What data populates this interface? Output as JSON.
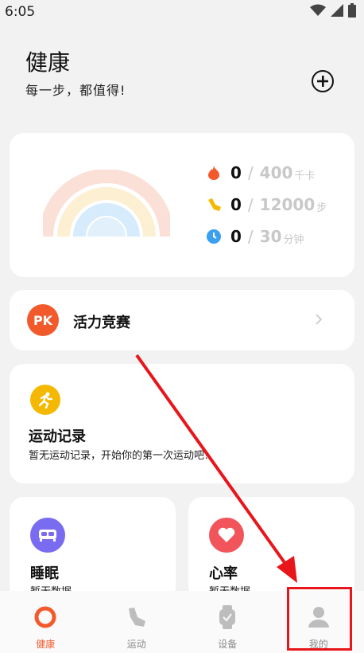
{
  "status_bar": {
    "time": "6:05"
  },
  "header": {
    "title": "健康",
    "subtitle": "每一步，都值得!"
  },
  "summary": {
    "stats": [
      {
        "icon": "flame-icon",
        "value": "0",
        "goal": "400",
        "unit": "千卡",
        "color": "#f25a2c"
      },
      {
        "icon": "shoe-icon",
        "value": "0",
        "goal": "12000",
        "unit": "步",
        "color": "#f5b800"
      },
      {
        "icon": "clock-icon",
        "value": "0",
        "goal": "30",
        "unit": "分钟",
        "color": "#3ba0f0"
      }
    ],
    "separator": "/"
  },
  "pk": {
    "badge": "PK",
    "label": "活力竞赛"
  },
  "workout": {
    "title": "运动记录",
    "description": "暂无运动记录，开始你的第一次运动吧!"
  },
  "tiles": {
    "sleep": {
      "title": "睡眠",
      "subtitle": "暂无数据",
      "color": "#7a6cf0"
    },
    "heart": {
      "title": "心率",
      "subtitle": "暂无数据",
      "color": "#f2545b"
    }
  },
  "nav": {
    "items": [
      {
        "label": "健康",
        "active": true
      },
      {
        "label": "运动",
        "active": false
      },
      {
        "label": "设备",
        "active": false
      },
      {
        "label": "我的",
        "active": false
      }
    ]
  },
  "colors": {
    "accent": "#f25a2c",
    "annotation": "#e8151b"
  }
}
